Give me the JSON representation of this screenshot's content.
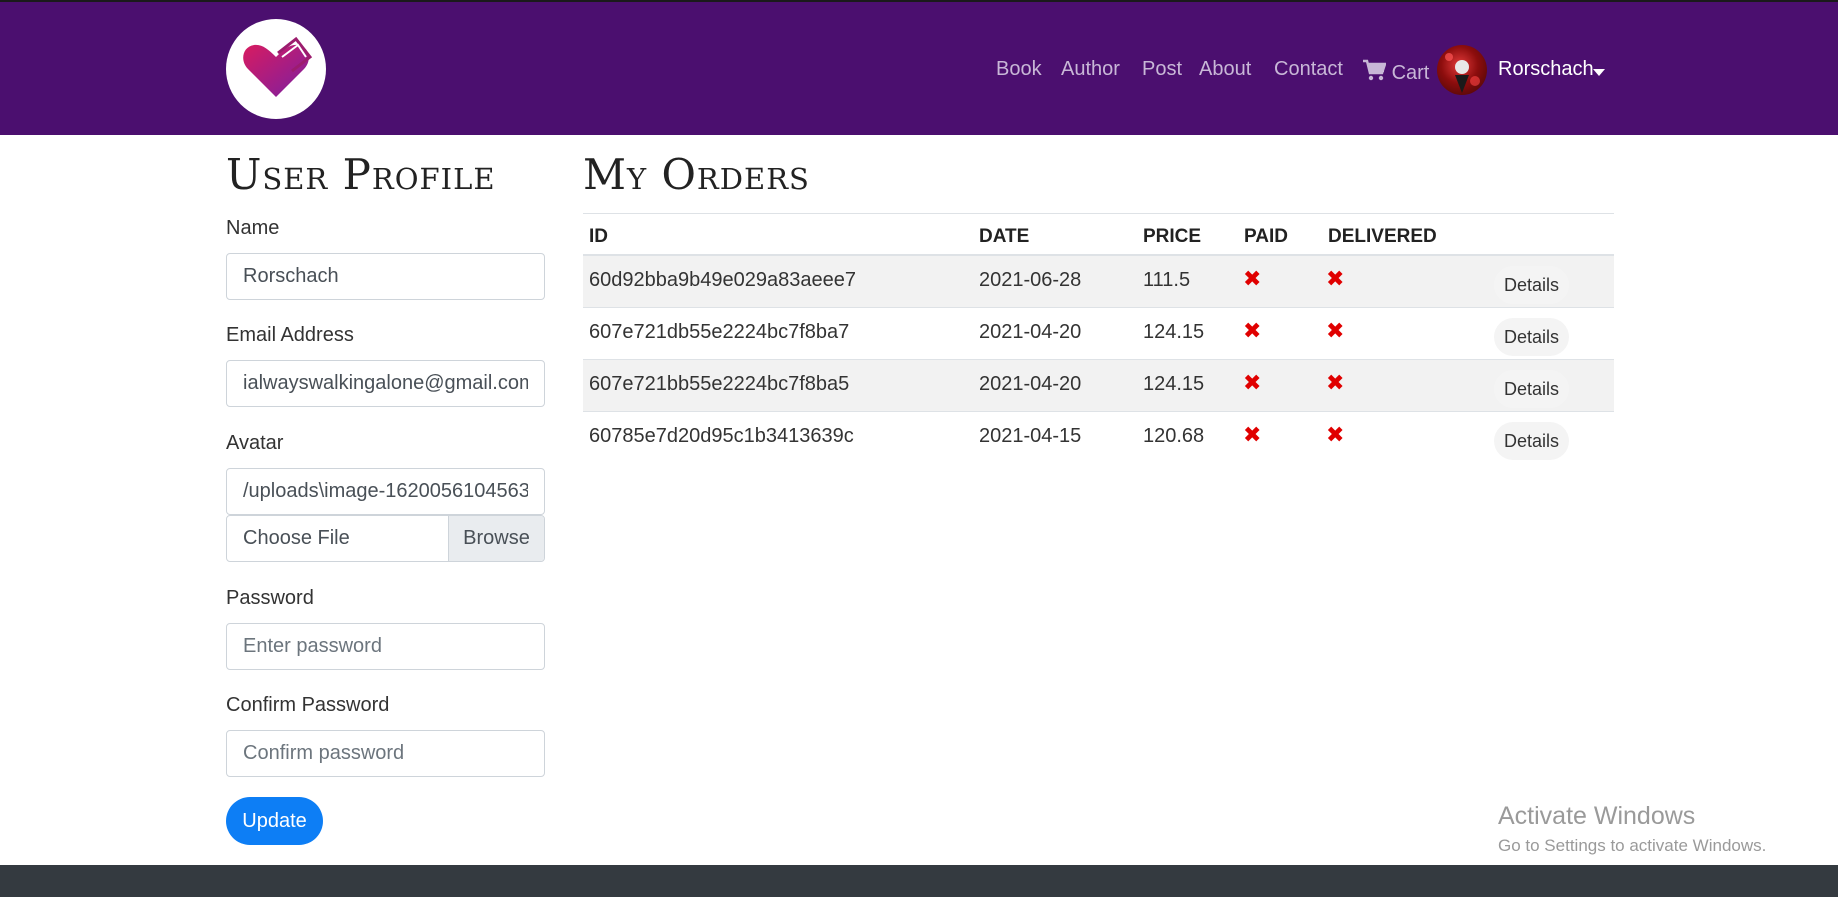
{
  "navbar": {
    "brand_icon": "heart-book-icon",
    "links": [
      {
        "label": "Book"
      },
      {
        "label": "Author"
      },
      {
        "label": "Post"
      },
      {
        "label": "About"
      },
      {
        "label": "Contact"
      }
    ],
    "cart_label": "Cart",
    "cart_icon": "cart-icon",
    "user_name": "Rorschach",
    "background": "#4b0f6f"
  },
  "profile": {
    "title": "User Profile",
    "name_label": "Name",
    "name_value": "Rorschach",
    "email_label": "Email Address",
    "email_value": "ialwayswalkingalone@gmail.com",
    "avatar_label": "Avatar",
    "avatar_value": "/uploads\\image-1620056104563",
    "file_label": "Choose File",
    "browse_label": "Browse",
    "password_label": "Password",
    "password_placeholder": "Enter password",
    "confirm_label": "Confirm Password",
    "confirm_placeholder": "Confirm password",
    "update_label": "Update",
    "update_color": "#0d7ef5"
  },
  "orders": {
    "title": "My Orders",
    "columns": [
      "ID",
      "DATE",
      "PRICE",
      "PAID",
      "DELIVERED"
    ],
    "details_label": "Details",
    "status_icon": "x-icon",
    "status_color": "#e00000",
    "rows": [
      {
        "id": "60d92bba9b49e029a83aeee7",
        "date": "2021-06-28",
        "price": "111.5",
        "paid_mark": "✖",
        "delivered_mark": "✖"
      },
      {
        "id": "607e721db55e2224bc7f8ba7",
        "date": "2021-04-20",
        "price": "124.15",
        "paid_mark": "✖",
        "delivered_mark": "✖"
      },
      {
        "id": "607e721bb55e2224bc7f8ba5",
        "date": "2021-04-20",
        "price": "124.15",
        "paid_mark": "✖",
        "delivered_mark": "✖"
      },
      {
        "id": "60785e7d20d95c1b3413639c",
        "date": "2021-04-15",
        "price": "120.68",
        "paid_mark": "✖",
        "delivered_mark": "✖"
      }
    ]
  },
  "watermark": {
    "title": "Activate Windows",
    "subtitle": "Go to Settings to activate Windows."
  }
}
